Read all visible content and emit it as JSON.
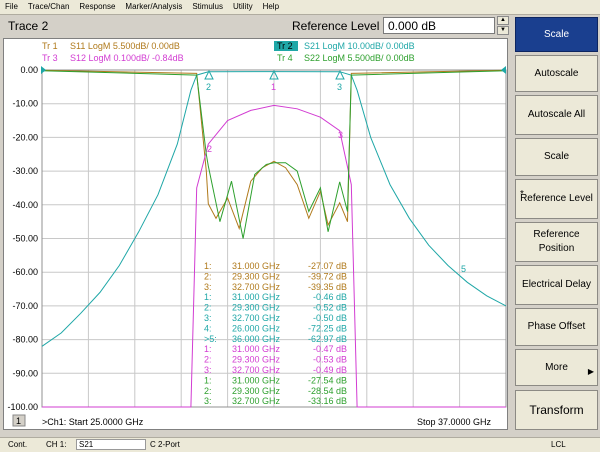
{
  "menu": [
    "File",
    "Trace/Chan",
    "Response",
    "Marker/Analysis",
    "Stimulus",
    "Utility",
    "Help"
  ],
  "title": {
    "trace": "Trace 2",
    "ref_label": "Reference Level",
    "ref_value": "0.000 dB"
  },
  "traces": [
    {
      "id": "Tr 1",
      "param": "S11 LogM 5.500dB/  0.00dB",
      "color": "#b07a1c"
    },
    {
      "id": "Tr 2",
      "param": "S21 LogM 10.00dB/  0.00dB",
      "color": "#1fa7a7",
      "active": true
    },
    {
      "id": "Tr 3",
      "param": "S12 LogM 0.100dB/  -0.84dB",
      "color": "#d23cd2"
    },
    {
      "id": "Tr 4",
      "param": "S22 LogM 5.500dB/  0.00dB",
      "color": "#2ea02e"
    }
  ],
  "y_ticks": [
    "0.00",
    "-10.00",
    "-20.00",
    "-30.00",
    "-40.00",
    "-50.00",
    "-60.00",
    "-70.00",
    "-80.00",
    "-90.00",
    "-100.00"
  ],
  "markers_table": [
    {
      "n": "1:",
      "f": "31.000 GHz",
      "v": "-27.07 dB",
      "color": "#b07a1c"
    },
    {
      "n": "2:",
      "f": "29.300 GHz",
      "v": "-39.72 dB",
      "color": "#b07a1c"
    },
    {
      "n": "3:",
      "f": "32.700 GHz",
      "v": "-39.35 dB",
      "color": "#b07a1c"
    },
    {
      "n": "1:",
      "f": "31.000 GHz",
      "v": "-0.46 dB",
      "color": "#1fa7a7"
    },
    {
      "n": "2:",
      "f": "29.300 GHz",
      "v": "-0.52 dB",
      "color": "#1fa7a7"
    },
    {
      "n": "3:",
      "f": "32.700 GHz",
      "v": "-0.50 dB",
      "color": "#1fa7a7"
    },
    {
      "n": "4:",
      "f": "26.000 GHz",
      "v": "-72.25 dB",
      "color": "#1fa7a7"
    },
    {
      "n": ">5:",
      "f": "36.000 GHz",
      "v": "-62.97 dB",
      "color": "#1fa7a7"
    },
    {
      "n": "1:",
      "f": "31.000 GHz",
      "v": "-0.47 dB",
      "color": "#d23cd2"
    },
    {
      "n": "2:",
      "f": "29.300 GHz",
      "v": "-0.53 dB",
      "color": "#d23cd2"
    },
    {
      "n": "3:",
      "f": "32.700 GHz",
      "v": "-0.49 dB",
      "color": "#d23cd2"
    },
    {
      "n": "1:",
      "f": "31.000 GHz",
      "v": "-27.54 dB",
      "color": "#2ea02e"
    },
    {
      "n": "2:",
      "f": "29.300 GHz",
      "v": "-28.54 dB",
      "color": "#2ea02e"
    },
    {
      "n": "3:",
      "f": "32.700 GHz",
      "v": "-33.16 dB",
      "color": "#2ea02e"
    }
  ],
  "footer": {
    "channel_num": "1",
    "start": ">Ch1: Start  25.0000 GHz",
    "stop": "Stop  37.0000 GHz"
  },
  "softkeys": [
    "Scale",
    "Autoscale",
    "Autoscale All",
    "Scale",
    "Reference Level",
    "Reference Position",
    "Electrical Delay",
    "Phase Offset",
    "More",
    "Transform"
  ],
  "status": {
    "cont": "Cont.",
    "ch": "CH 1:",
    "param": "S21",
    "port": "C  2-Port",
    "lcl": "LCL"
  },
  "chart_data": {
    "type": "line",
    "xlim": [
      25,
      37
    ],
    "ylim": [
      -100,
      0
    ],
    "grid": true,
    "x_unit": "GHz",
    "series": [
      {
        "name": "S11",
        "color": "#b07a1c",
        "x": [
          25,
          29.0,
          29.25,
          29.3,
          29.5,
          29.8,
          30.1,
          30.4,
          30.7,
          31.0,
          31.3,
          31.6,
          31.9,
          32.2,
          32.4,
          32.7,
          32.9,
          33.0,
          37
        ],
        "y": [
          -0.1,
          -1,
          -30,
          -39.7,
          -44,
          -38,
          -47,
          -33,
          -29,
          -27.1,
          -29,
          -34,
          -44,
          -36,
          -46,
          -39.4,
          -45,
          -1,
          -0.1
        ]
      },
      {
        "name": "S21",
        "color": "#1fa7a7",
        "x": [
          25,
          25.5,
          26.0,
          26.5,
          27.0,
          27.5,
          28.0,
          28.5,
          28.85,
          29.0,
          29.3,
          31.0,
          32.7,
          33.0,
          33.15,
          33.5,
          34.0,
          34.5,
          35.0,
          35.5,
          36.0,
          36.5,
          37.0
        ],
        "y": [
          -82,
          -78,
          -72.2,
          -66,
          -58,
          -48,
          -37,
          -22,
          -6,
          -1.5,
          -0.52,
          -0.46,
          -0.5,
          -1.5,
          -6,
          -20,
          -34,
          -44,
          -52,
          -58,
          -63,
          -67,
          -70
        ]
      },
      {
        "name": "S12",
        "color": "#d23cd2",
        "x": [
          25,
          28.85,
          29.0,
          29.3,
          29.8,
          30.4,
          31.0,
          31.6,
          32.2,
          32.7,
          33.0,
          33.15,
          37
        ],
        "y": [
          -100,
          -100,
          -35,
          -22,
          -15,
          -12,
          -10.5,
          -11.5,
          -14,
          -18,
          -34,
          -100,
          -100
        ]
      },
      {
        "name": "S22",
        "color": "#2ea02e",
        "x": [
          25,
          29.0,
          29.25,
          29.3,
          29.6,
          29.9,
          30.2,
          30.5,
          30.8,
          31.0,
          31.3,
          31.6,
          31.9,
          32.2,
          32.4,
          32.7,
          32.9,
          33.0,
          37
        ],
        "y": [
          -0.2,
          -1.5,
          -25,
          -28.5,
          -45,
          -33,
          -50,
          -31,
          -28,
          -27.5,
          -27.5,
          -30,
          -42,
          -35,
          -48,
          -33.2,
          -42,
          -1.5,
          -0.2
        ]
      }
    ]
  }
}
